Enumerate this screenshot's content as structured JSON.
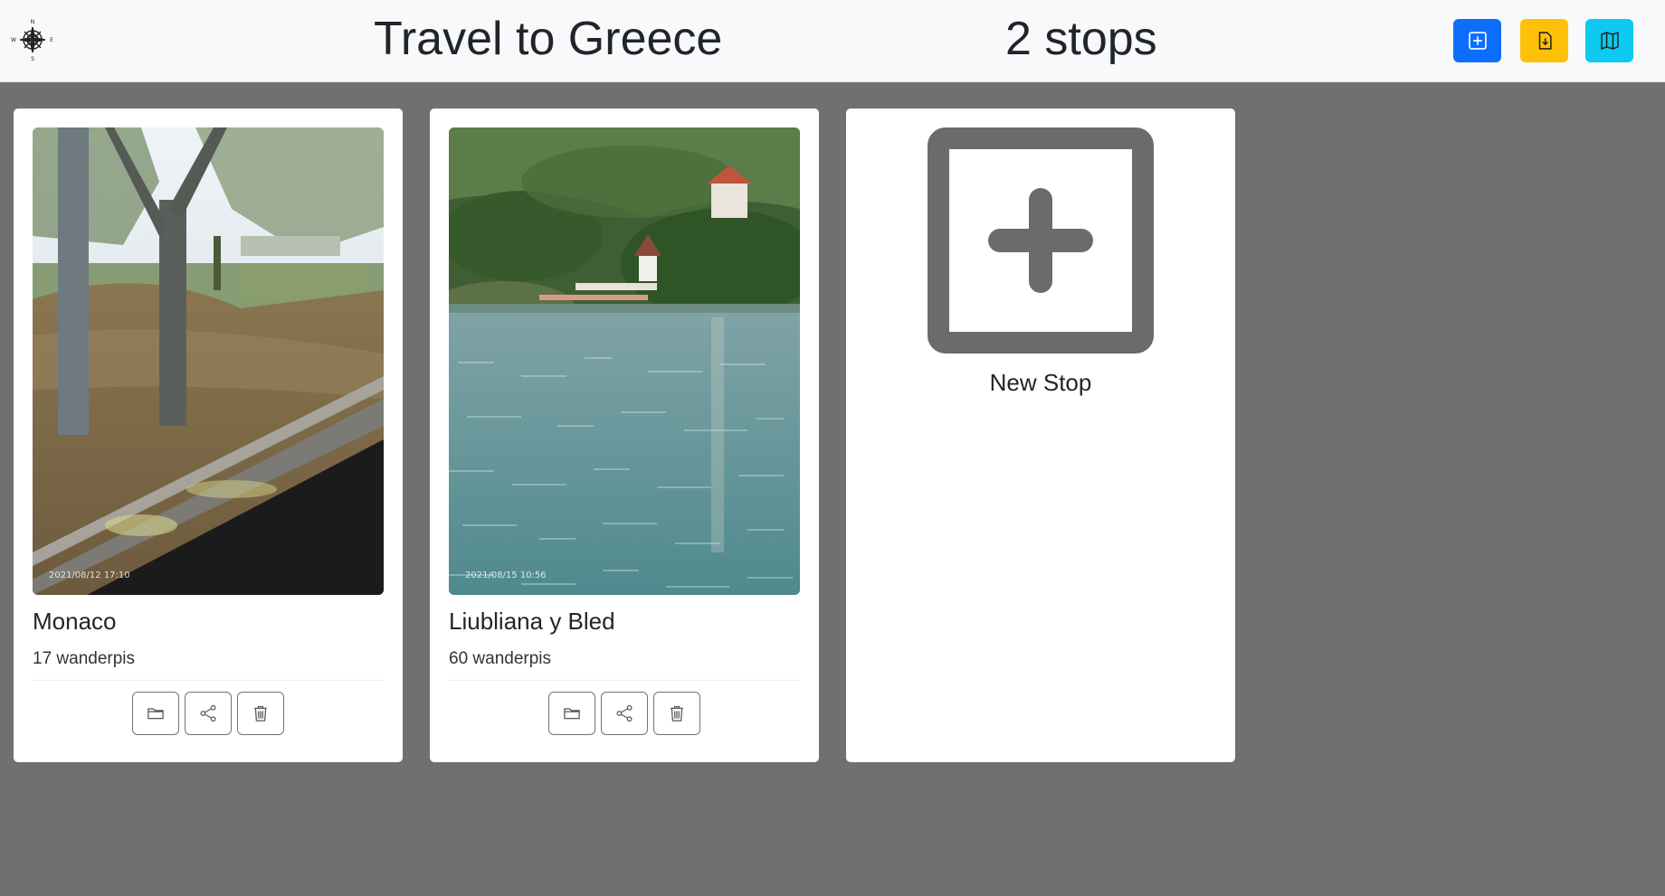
{
  "header": {
    "title": "Travel to Greece",
    "stops_count": "2 stops",
    "logo_icon": "compass-rose-icon",
    "buttons": [
      {
        "name": "add-stop",
        "icon": "plus-square-icon",
        "color": "#0d6efd"
      },
      {
        "name": "export",
        "icon": "file-download-icon",
        "color": "#ffc107"
      },
      {
        "name": "map",
        "icon": "map-icon",
        "color": "#0dcaf0"
      }
    ]
  },
  "stops": [
    {
      "name": "Monaco",
      "count": "17 wanderpis",
      "photo_stamp": "2021/08/12 17:10",
      "actions": [
        "folder-icon",
        "share-icon",
        "trash-icon"
      ]
    },
    {
      "name": "Liubliana y Bled",
      "count": "60 wanderpis",
      "photo_stamp": "2021/08/15 10:56",
      "actions": [
        "folder-icon",
        "share-icon",
        "trash-icon"
      ]
    }
  ],
  "new_stop": {
    "label": "New Stop",
    "icon": "plus-square-icon"
  },
  "colors": {
    "background": "#707070",
    "header": "#f8f9fa",
    "card": "#ffffff"
  }
}
